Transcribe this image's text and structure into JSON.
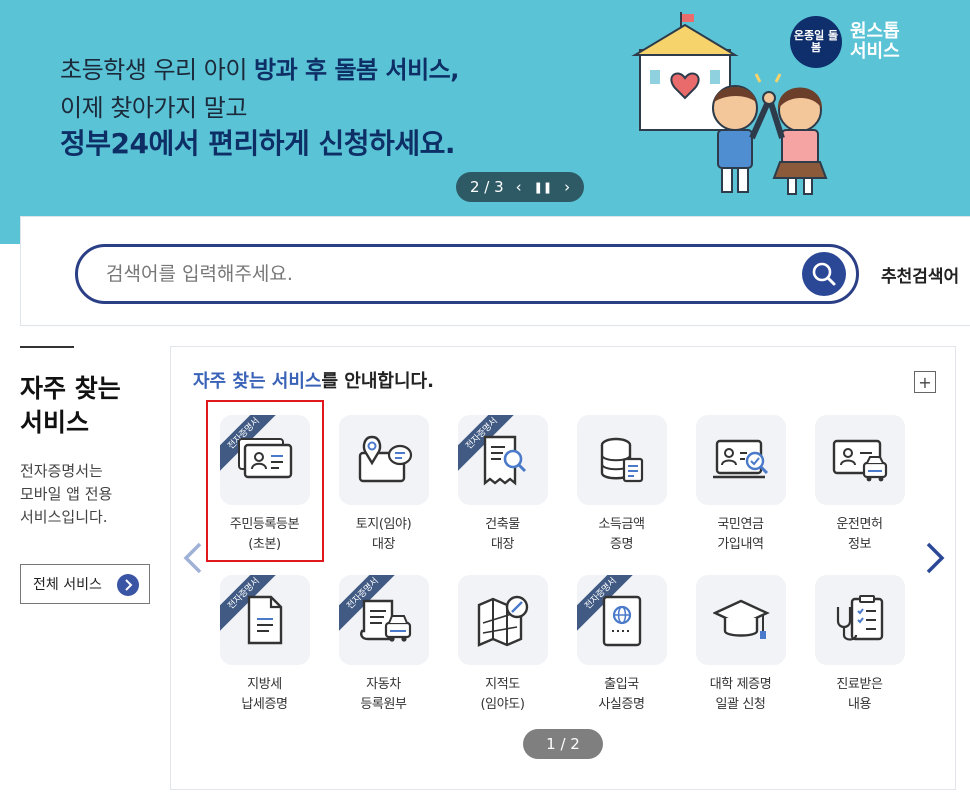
{
  "banner": {
    "line1_pre": "초등학생 우리 아이 ",
    "line1_hl": "방과 후 돌봄 서비스,",
    "line2": "이제 찾아가지 말고",
    "line3": "정부24에서 편리하게 신청하세요.",
    "pager_text": "2 / 3",
    "brand_logo": "온종일 돌봄",
    "brand_line1": "원스톱",
    "brand_line2": "서비스"
  },
  "search": {
    "placeholder": "검색어를 입력해주세요.",
    "value": "",
    "recommended_label": "추천검색어"
  },
  "left": {
    "title_line1": "자주 찾는",
    "title_line2": "서비스",
    "desc_line1": "전자증명서는",
    "desc_line2": "모바일 앱 전용",
    "desc_line3": "서비스입니다.",
    "all_services_label": "전체 서비스"
  },
  "services": {
    "heading_hl": "자주 찾는 서비스",
    "heading_rest": "를 안내합니다.",
    "plus": "+",
    "ribbon_text": "전자증명서",
    "items": [
      {
        "line1": "주민등록등본",
        "line2": "(초본)",
        "icon": "id-card-icon"
      },
      {
        "line1": "토지(임야)",
        "line2": "대장",
        "icon": "land-map-icon"
      },
      {
        "line1": "건축물",
        "line2": "대장",
        "icon": "building-document-icon"
      },
      {
        "line1": "소득금액",
        "line2": "증명",
        "icon": "database-document-icon"
      },
      {
        "line1": "국민연금",
        "line2": "가입내역",
        "icon": "pension-monitor-icon"
      },
      {
        "line1": "운전면허",
        "line2": "정보",
        "icon": "driver-license-icon"
      },
      {
        "line1": "지방세",
        "line2": "납세증명",
        "icon": "tax-document-icon"
      },
      {
        "line1": "자동차",
        "line2": "등록원부",
        "icon": "car-registration-icon"
      },
      {
        "line1": "지적도",
        "line2": "(임야도)",
        "icon": "cadastral-map-icon"
      },
      {
        "line1": "출입국",
        "line2": "사실증명",
        "icon": "passport-icon"
      },
      {
        "line1": "대학 제증명",
        "line2": "일괄 신청",
        "icon": "graduation-cap-icon"
      },
      {
        "line1": "진료받은",
        "line2": "내용",
        "icon": "medical-record-icon"
      }
    ],
    "page_indicator": "1 / 2"
  }
}
